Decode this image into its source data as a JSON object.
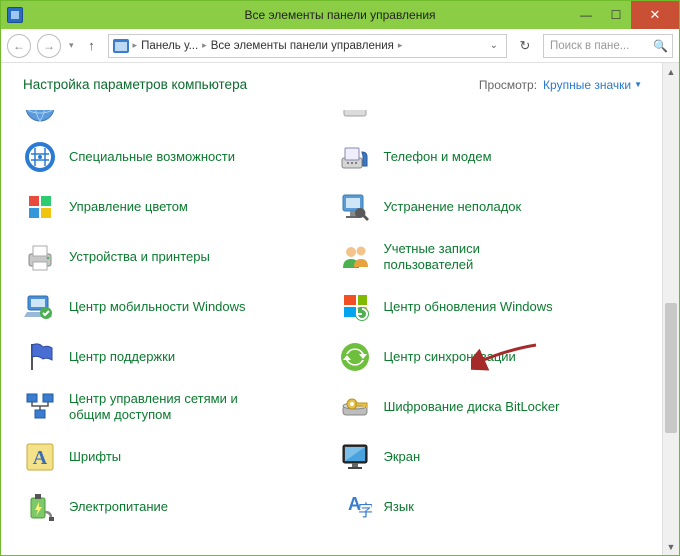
{
  "window": {
    "title": "Все элементы панели управления"
  },
  "nav": {
    "breadcrumb1": "Панель у...",
    "breadcrumb2": "Все элементы панели управления",
    "search_placeholder": "Поиск в пане..."
  },
  "header": {
    "title": "Настройка параметров компьютера",
    "view_label": "Просмотр:",
    "view_value": "Крупные значки"
  },
  "items_left": [
    {
      "label": "",
      "icon": "globe-partial"
    },
    {
      "label": "Специальные возможности",
      "icon": "accessibility"
    },
    {
      "label": "Управление цветом",
      "icon": "color"
    },
    {
      "label": "Устройства и принтеры",
      "icon": "printer"
    },
    {
      "label": "Центр мобильности Windows",
      "icon": "mobility"
    },
    {
      "label": "Центр поддержки",
      "icon": "flag"
    },
    {
      "label": "Центр управления сетями и общим доступом",
      "icon": "network"
    },
    {
      "label": "Шрифты",
      "icon": "font"
    },
    {
      "label": "Электропитание",
      "icon": "power"
    }
  ],
  "items_right": [
    {
      "label": "",
      "icon": "fax-partial"
    },
    {
      "label": "Телефон и модем",
      "icon": "phone"
    },
    {
      "label": "Устранение неполадок",
      "icon": "troubleshoot"
    },
    {
      "label": "Учетные записи пользователей",
      "icon": "users"
    },
    {
      "label": "Центр обновления Windows",
      "icon": "update"
    },
    {
      "label": "Центр синхронизации",
      "icon": "sync"
    },
    {
      "label": "Шифрование диска BitLocker",
      "icon": "bitlocker"
    },
    {
      "label": "Экран",
      "icon": "screen"
    },
    {
      "label": "Язык",
      "icon": "lang"
    }
  ]
}
